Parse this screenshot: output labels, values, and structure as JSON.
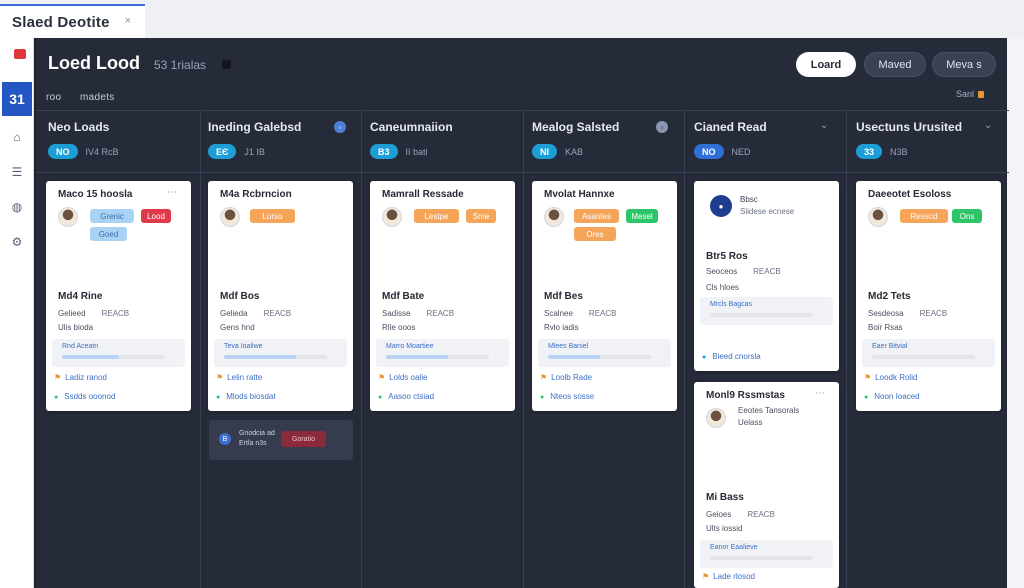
{
  "browser": {
    "tab_title": "Slaed Deotite",
    "close_glyph": "×"
  },
  "rail": {
    "active_label": "31"
  },
  "board": {
    "title": "Loed Lood",
    "subtitle": "53 1rialas",
    "nav": [
      "roo",
      "madets"
    ],
    "buttons": [
      "Loard",
      "Maved",
      "Meva s"
    ],
    "sort_label": "Sanl"
  },
  "columns": [
    {
      "title": "Neo Loads",
      "badge": "NO",
      "count": "IV4 RcB"
    },
    {
      "title": "Ineding Galebsd",
      "badge": "ЕЄ",
      "count": "J1 IB"
    },
    {
      "title": "Caneumnaiion",
      "badge": "B3",
      "count": "II bati"
    },
    {
      "title": "Mealog Salsted",
      "badge": "NI",
      "count": "KAB"
    },
    {
      "title": "Cianed Read",
      "badge": "NO",
      "count": "NED"
    },
    {
      "title": "Usectuns Urusited",
      "badge": "33",
      "count": "N3B"
    }
  ],
  "cards": [
    {
      "name": "Maco 15 hoosla",
      "tags": [
        "Grenic",
        "Lood",
        "Goed"
      ],
      "value_title": "Md4 Rine",
      "rows": [
        [
          "Gelieed",
          "REACB"
        ],
        [
          "Ulis bioda"
        ]
      ],
      "note": "Rnd Aceatn",
      "note_pct": 0.55,
      "foot1": "Ladiz ranod",
      "foot2": "Ssdds ooonod"
    },
    {
      "name": "M4a Rcbrncion",
      "tags": [
        "Lurso"
      ],
      "value_title": "Mdf Bos",
      "rows": [
        [
          "Gelieda",
          "REACB"
        ],
        [
          "Gens hnd"
        ]
      ],
      "note": "Teva Ioaliwe",
      "note_pct": 0.7,
      "foot1": "Lelin ratte",
      "foot2": "Mlods biosdat"
    },
    {
      "name": "Mamrall Ressade",
      "tags": [
        "Lestpe",
        "Sme"
      ],
      "value_title": "Mdf Bate",
      "rows": [
        [
          "Sadisse",
          "REACB"
        ],
        [
          "Rlle ooos"
        ]
      ],
      "note": "Marro Moartiee",
      "note_pct": 0.6,
      "foot1": "Lolds oalie",
      "foot2": "Aasoo ctsiad"
    },
    {
      "name": "Mvolat Hannxe",
      "tags": [
        "Asantes",
        "Mesel",
        "Ores"
      ],
      "value_title": "Mdf Bes",
      "rows": [
        [
          "Scalnee",
          "REACB"
        ],
        [
          "Rvlo iadis"
        ]
      ],
      "note": "Mlees Baniel",
      "note_pct": 0.5,
      "foot1": "Loolb Rade",
      "foot2": "Nteos sosse"
    },
    {
      "name": "Bbsc",
      "sub": "Siidese ecnese",
      "value_title": "Btr5 Ros",
      "rows": [
        [
          "Seoceos",
          "REACB"
        ],
        [
          "Cls hloes"
        ]
      ],
      "note": "Mrcls Bagcas",
      "note_pct": 0.0,
      "foot2": "Bieed cnorsla"
    },
    {
      "name": "Daeeotet Esoloss",
      "tags": [
        "Resscd",
        "Ons"
      ],
      "value_title": "Md2 Tets",
      "rows": [
        [
          "Sesdeosa",
          "REACB"
        ],
        [
          "Boir Rsas"
        ]
      ],
      "note": "Eaer Bitvial",
      "note_pct": 0.0,
      "foot1": "Loodk Rolid",
      "foot2": "Noon Ioaced"
    },
    {
      "name": "Monl9 Rssmstas",
      "sub": "Eeotes Tansorals",
      "sub2": "Uelass",
      "value_title": "Mi Bass",
      "rows": [
        [
          "Geioes",
          "REACB"
        ],
        [
          "Ults iossid"
        ]
      ],
      "note": "Eanor Eaalieve",
      "note_pct": 0.0,
      "foot1": "Lade rlosod"
    }
  ],
  "mini_card": {
    "badge": "B",
    "line1": "Gnodcia ad",
    "line2": "Ertla n3s",
    "tag": "Goratio"
  }
}
